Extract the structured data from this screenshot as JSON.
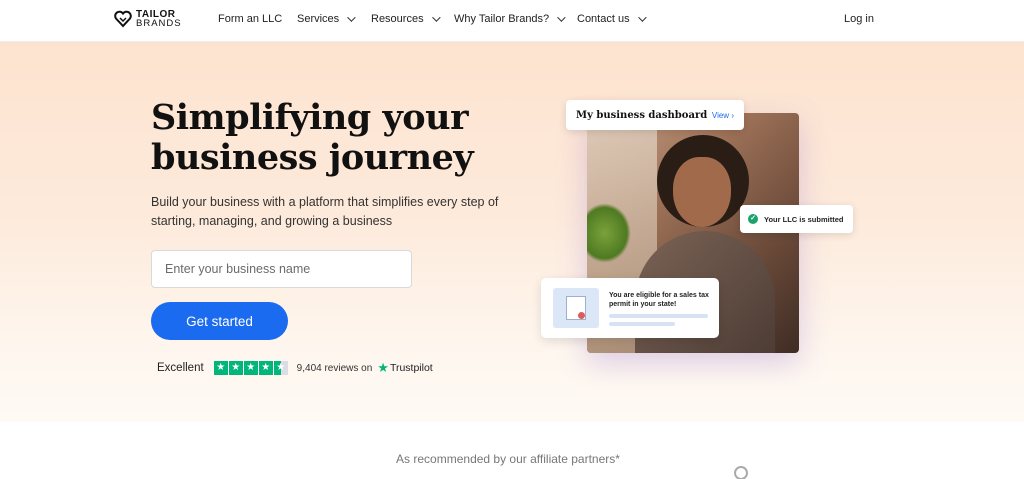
{
  "brand": {
    "line1": "TAILOR",
    "line2": "BRANDS"
  },
  "nav": {
    "items": [
      {
        "label": "Form an LLC",
        "dropdown": false
      },
      {
        "label": "Services",
        "dropdown": true
      },
      {
        "label": "Resources",
        "dropdown": true
      },
      {
        "label": "Why Tailor Brands?",
        "dropdown": true
      },
      {
        "label": "Contact us",
        "dropdown": true
      }
    ],
    "login": "Log in"
  },
  "hero": {
    "headline_line1": "Simplifying your",
    "headline_line2": "business journey",
    "subtext": "Build your business with a platform that simplifies every step of starting, managing, and growing a business",
    "input_placeholder": "Enter your business name",
    "cta": "Get started",
    "rating": {
      "label": "Excellent",
      "stars": 4.5,
      "reviews": "9,404 reviews on",
      "provider": "Trustpilot"
    }
  },
  "visual": {
    "dashboard_title": "My business dashboard",
    "dashboard_view": "View",
    "llc_status": "Your LLC is submitted",
    "permit_text": "You are eligible for a sales tax permit in your state!"
  },
  "partners": {
    "heading": "As recommended by our affiliate partners*"
  },
  "colors": {
    "accent": "#1a6bf0",
    "trustpilot": "#00b67a",
    "check": "#1aa36c"
  }
}
